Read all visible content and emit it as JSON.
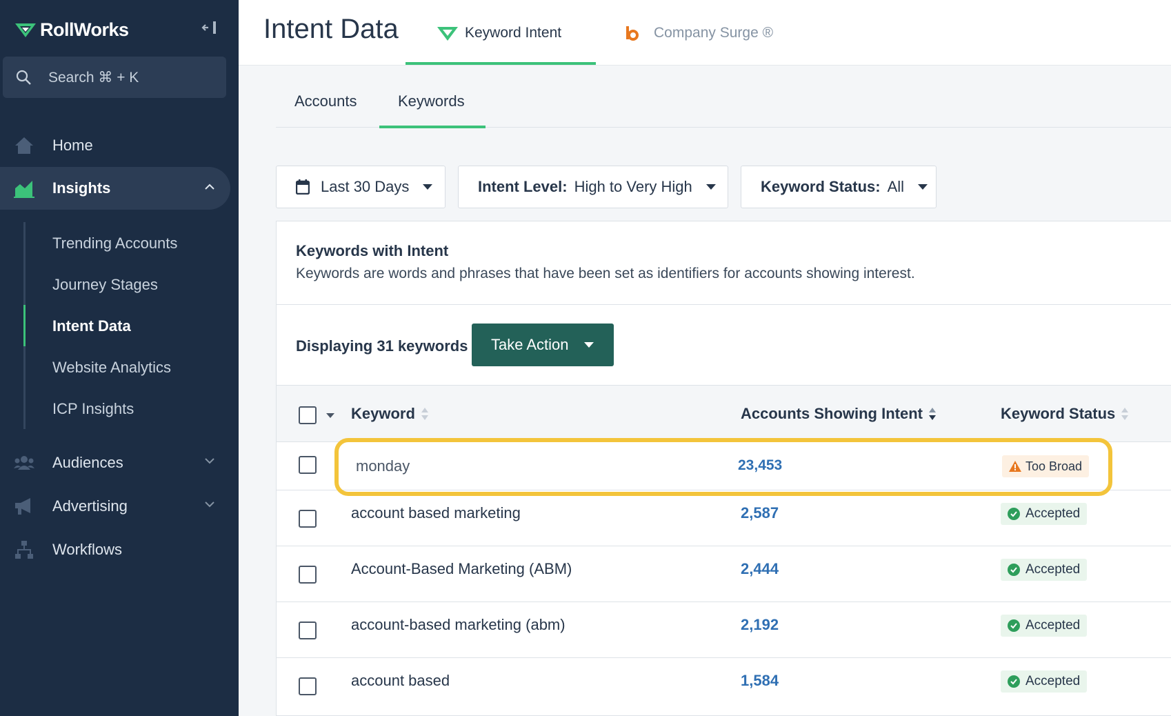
{
  "brand": {
    "name": "RollWorks",
    "accent": "#3cc27a"
  },
  "search": {
    "label": "Search ⌘ + K"
  },
  "nav": {
    "home": "Home",
    "insights": "Insights",
    "insights_sub": [
      "Trending Accounts",
      "Journey Stages",
      "Intent Data",
      "Website Analytics",
      "ICP Insights"
    ],
    "audiences": "Audiences",
    "advertising": "Advertising",
    "workflows": "Workflows"
  },
  "header": {
    "title": "Intent Data",
    "tabs": [
      {
        "label": "Keyword Intent",
        "active": true
      },
      {
        "label": "Company Surge ®",
        "active": false
      }
    ]
  },
  "subtabs": [
    "Accounts",
    "Keywords"
  ],
  "filters": {
    "date": "Last 30 Days",
    "intent_label": "Intent Level:",
    "intent_value": "High to Very High",
    "status_label": "Keyword Status:",
    "status_value": "All"
  },
  "panel": {
    "title": "Keywords with Intent",
    "description": "Keywords are words and phrases that have been set as identifiers for accounts showing interest.",
    "count_text": "Displaying 31 keywords",
    "action_button": "Take Action"
  },
  "table": {
    "columns": [
      "Keyword",
      "Accounts Showing Intent",
      "Keyword Status"
    ],
    "rows": [
      {
        "keyword": "monday",
        "accounts": "23,453",
        "status": "Too Broad"
      },
      {
        "keyword": "account based marketing",
        "accounts": "2,587",
        "status": "Accepted"
      },
      {
        "keyword": "Account-Based Marketing (ABM)",
        "accounts": "2,444",
        "status": "Accepted"
      },
      {
        "keyword": "account-based marketing (abm)",
        "accounts": "2,192",
        "status": "Accepted"
      },
      {
        "keyword": "account based",
        "accounts": "1,584",
        "status": "Accepted"
      }
    ]
  },
  "colors": {
    "highlight": "#f3c43b",
    "link": "#2f6fb3",
    "button": "#236158",
    "sidebar": "#1c2d44"
  }
}
